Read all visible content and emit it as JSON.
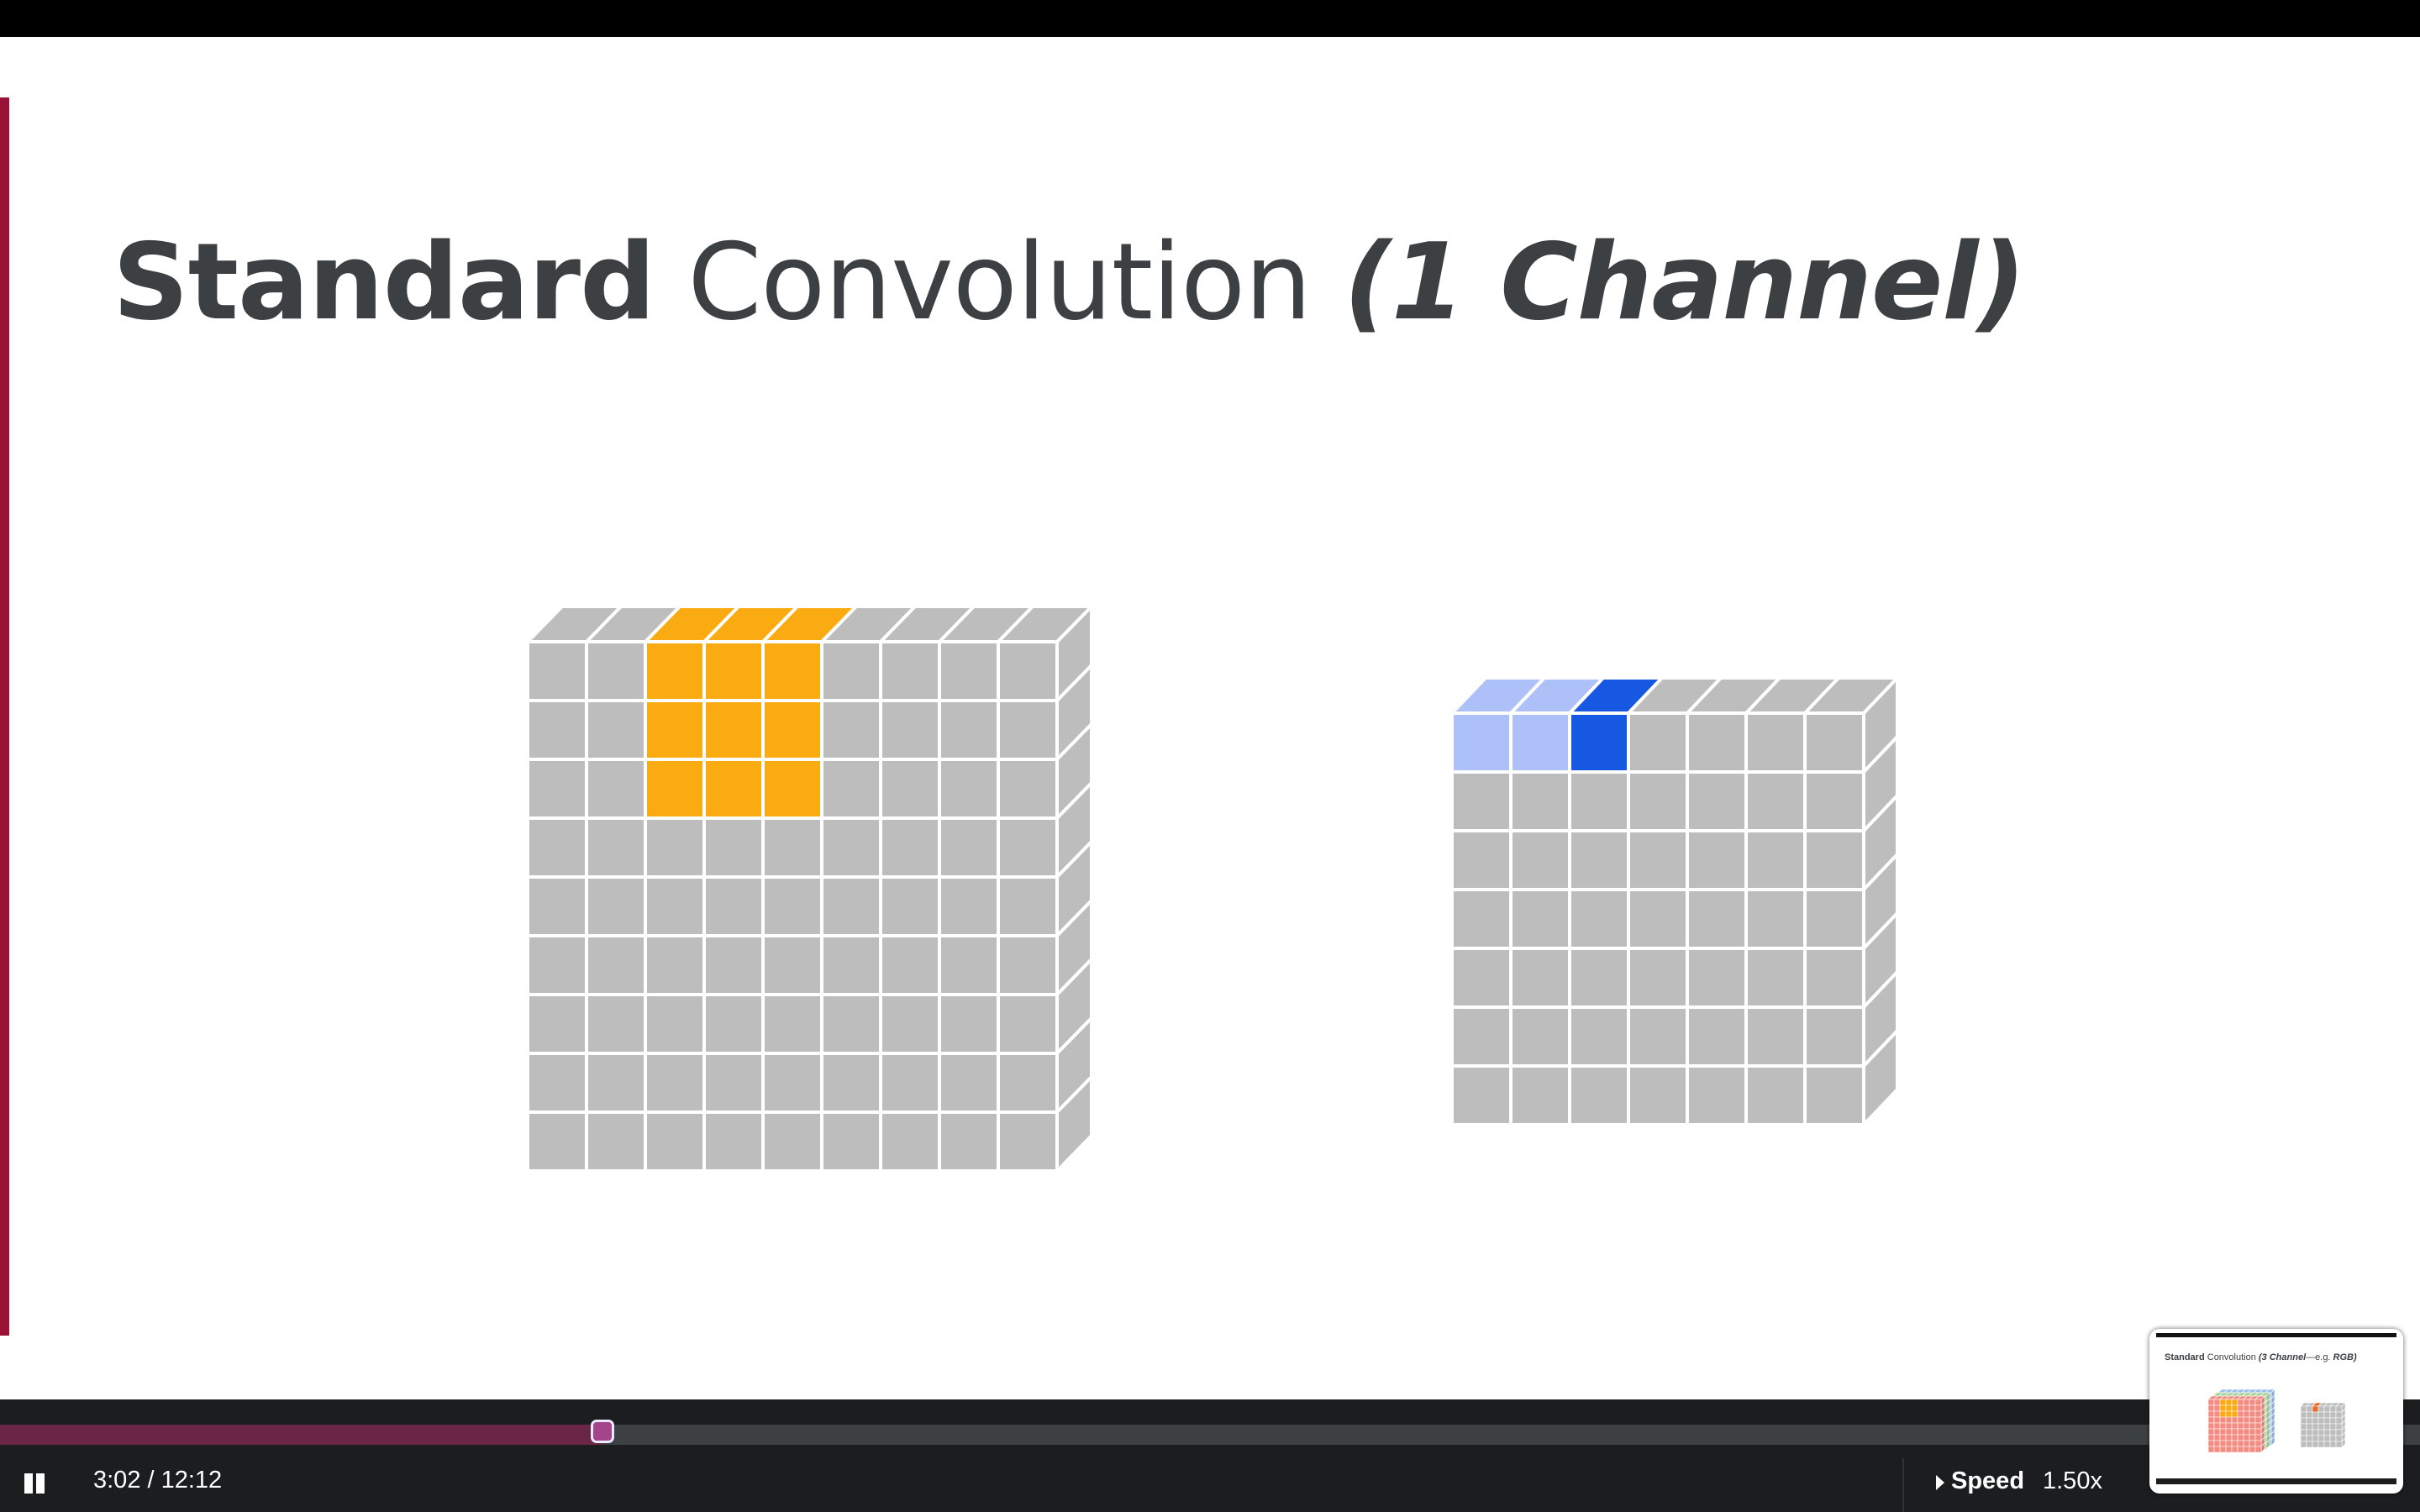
{
  "slide": {
    "title": {
      "bold": "Standard",
      "regular": " Convolution ",
      "italic": "(1 Channel)"
    },
    "accent_color": "#9b1237"
  },
  "diagram": {
    "input_grid": {
      "rows": 9,
      "cols": 9,
      "highlight_color": "#fbab12",
      "highlight_rows": [
        0,
        1,
        2
      ],
      "highlight_cols": [
        2,
        3,
        4
      ],
      "cell_color": "#bdbdbd"
    },
    "output_grid": {
      "rows": 7,
      "cols": 7,
      "visited_color": "#aec0f8",
      "current_color": "#1758e3",
      "visited_cells": [
        [
          0,
          0
        ],
        [
          0,
          1
        ]
      ],
      "current_cell": [
        0,
        2
      ],
      "cell_color": "#bdbdbd"
    }
  },
  "player": {
    "play_state_icon": "pause-icon",
    "current_time": "3:02",
    "duration": "12:12",
    "time_text": "3:02 / 12:12",
    "progress_fraction": 0.249,
    "speed_label": "Speed",
    "speed_value": "1.50x",
    "progress_color": "#6b2545",
    "handle_color": "#a4448a"
  },
  "preview": {
    "title_bold": "Standard",
    "title_regular": " Convolution ",
    "title_italic": "(3 Channel",
    "title_suffix": "—e.g. ",
    "title_italic2": "RGB)"
  }
}
